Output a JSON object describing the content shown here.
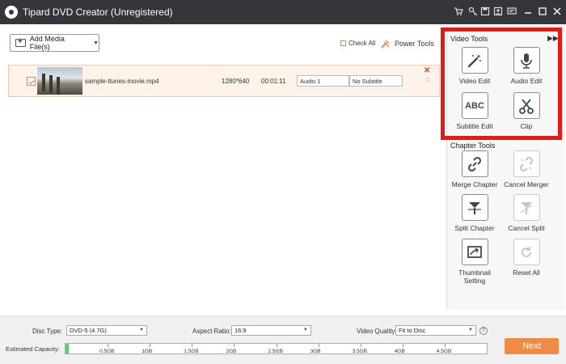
{
  "window": {
    "title": "Tipard DVD Creator (Unregistered)"
  },
  "titlebar_icons": [
    "cart-icon",
    "key-icon",
    "save-icon",
    "user-icon",
    "feedback-icon",
    "minimize-icon",
    "maximize-icon",
    "close-icon"
  ],
  "toolbar": {
    "add_media_label": "Add Media File(s)",
    "check_all_label": "Check All",
    "power_tools_label": "Power Tools"
  },
  "file": {
    "name": "sample-itunes-movie.mp4",
    "resolution": "1280*640",
    "duration": "00:01:11",
    "audio": "Audio 1",
    "subtitle": "No Subtitle"
  },
  "video_tools": {
    "heading": "Video Tools",
    "items": [
      {
        "label": "Video Edit",
        "icon": "magic-wand-icon"
      },
      {
        "label": "Audio Edit",
        "icon": "microphone-icon"
      },
      {
        "label": "Subtitle Edit",
        "icon": "abc-icon"
      },
      {
        "label": "Clip",
        "icon": "scissors-icon"
      }
    ]
  },
  "chapter_tools": {
    "heading": "Chapter Tools",
    "items": [
      {
        "label": "Merge Chapter",
        "icon": "link-icon",
        "enabled": true
      },
      {
        "label": "Cancel Merger",
        "icon": "broken-link-icon",
        "enabled": false
      },
      {
        "label": "Split Chapter",
        "icon": "split-icon",
        "enabled": true
      },
      {
        "label": "Cancel Split",
        "icon": "cancel-split-icon",
        "enabled": false
      },
      {
        "label": "Thumbnail Setting",
        "icon": "thumbnail-icon",
        "enabled": true
      },
      {
        "label": "Reset All",
        "icon": "reset-icon",
        "enabled": false
      }
    ]
  },
  "bottom": {
    "disc_type_label": "Disc Type:",
    "disc_type_value": "DVD-5 (4.7G)",
    "aspect_label": "Aspect Ratio:",
    "aspect_value": "16:9",
    "quality_label": "Video Quality:",
    "quality_value": "Fit to Disc",
    "capacity_label": "Estimated Capacity:",
    "capacity_ticks": [
      "0.5GB",
      "1GB",
      "1.5GB",
      "2GB",
      "2.5GB",
      "3GB",
      "3.5GB",
      "4GB",
      "4.5GB"
    ],
    "capacity_used_gb": 0.03,
    "next_label": "Next"
  },
  "colors": {
    "accent": "#f08b46",
    "highlight": "#e11a1a",
    "capacity": "#4cd964",
    "titlebar": "#34363c"
  }
}
